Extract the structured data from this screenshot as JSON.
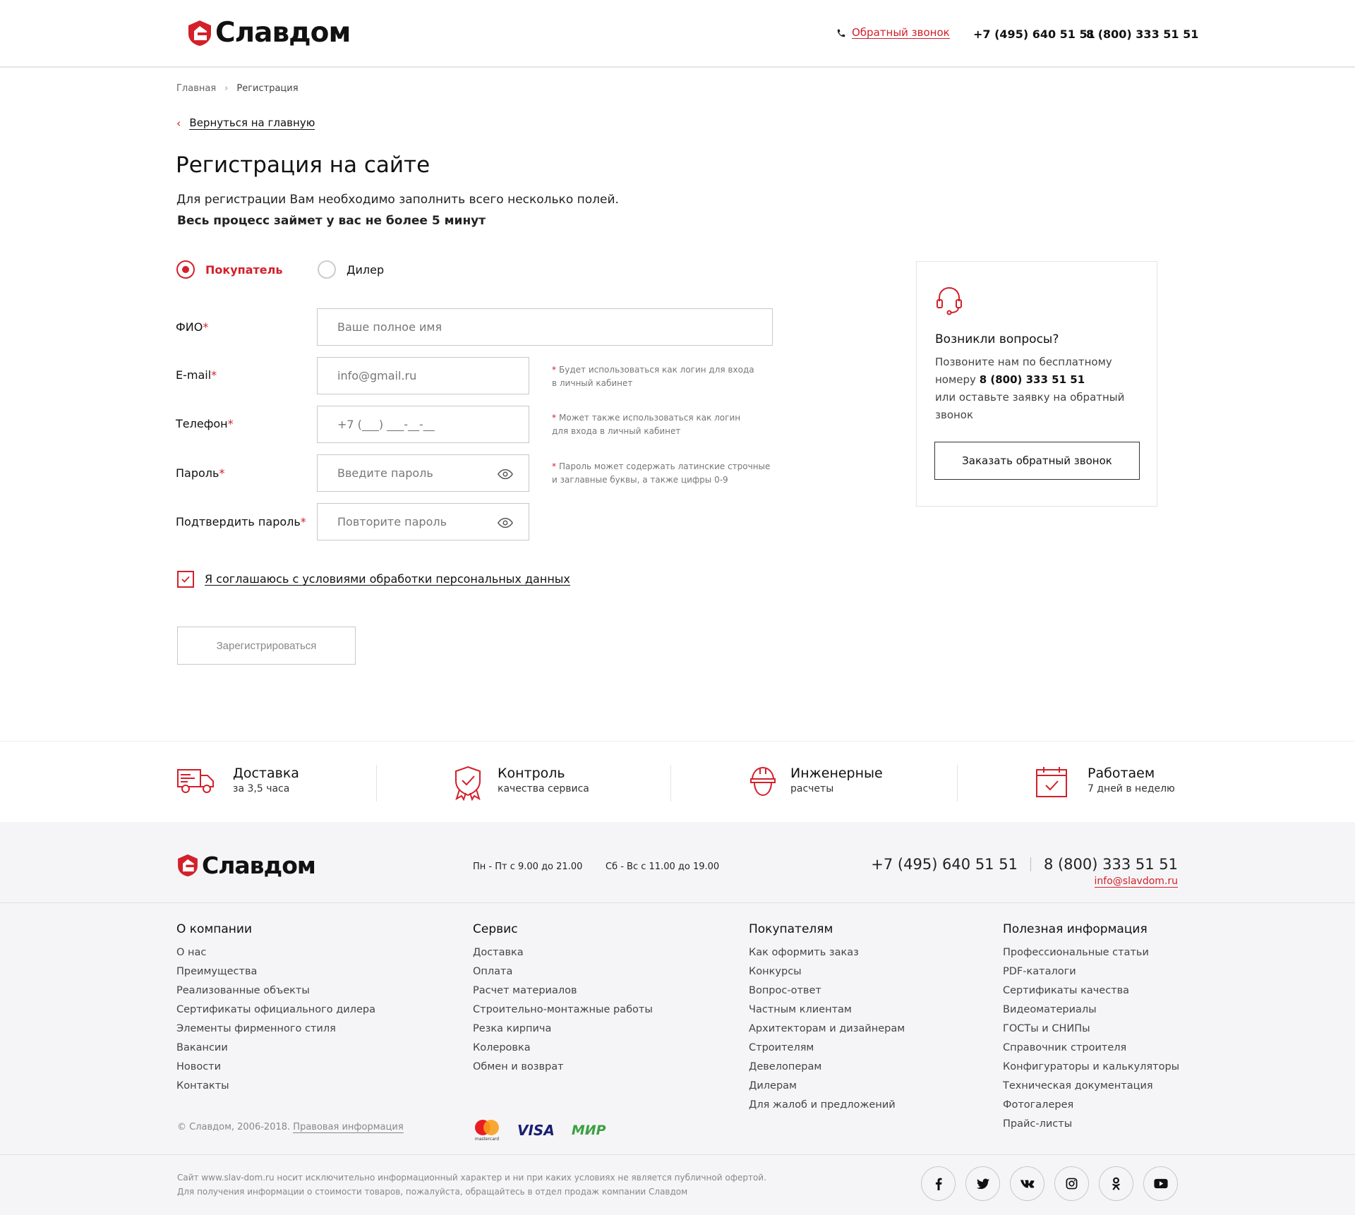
{
  "brand": {
    "name": "Славдом",
    "accent": "#d3202a"
  },
  "header": {
    "callback_link": "Обратный звонок",
    "phone1": "+7 (495) 640 51 51",
    "phone2": "8 (800) 333 51 51"
  },
  "breadcrumb": {
    "home": "Главная",
    "current": "Регистрация"
  },
  "back_link": "Вернуться на главную",
  "page": {
    "title": "Регистрация на сайте",
    "subtitle": "Для регистрации Вам необходимо заполнить всего несколько полей.",
    "subtitle_bold": "Весь процесс займет у вас не более 5 минут"
  },
  "user_type": {
    "buyer": "Покупатель",
    "dealer": "Дилер",
    "selected": "Покупатель"
  },
  "form": {
    "fio": {
      "label": "ФИО",
      "placeholder": "Ваше полное имя"
    },
    "email": {
      "label": "E-mail",
      "placeholder": "info@gmail.ru",
      "hint_line1": "Будет использоваться как логин для входа",
      "hint_line2": "в личный кабинет"
    },
    "phone": {
      "label": "Телефон",
      "placeholder": "+7 (___) ___-__-__",
      "hint_line1": "Может также использоваться как логин",
      "hint_line2": "для входа в личный кабинет"
    },
    "password": {
      "label": "Пароль",
      "placeholder": "Введите пароль",
      "hint_line1": "Пароль может содержать латинские строчные",
      "hint_line2": "и заглавные буквы, а также цифры 0-9"
    },
    "confirm": {
      "label": "Подтвердить пароль",
      "placeholder": "Повторите пароль"
    },
    "required_mark": "*",
    "agree_label": "Я соглашаюсь с условиями обработки персональных данных",
    "agree_checked": true,
    "submit": "Зарегистрироваться"
  },
  "help": {
    "title": "Возникли вопросы?",
    "text1": "Позвоните нам по бесплатному номеру",
    "phone": "8 (800) 333 51 51",
    "text2": "или оставьте заявку на обратный звонок",
    "button": "Заказать обратный звонок"
  },
  "features": [
    {
      "icon": "truck-icon",
      "title": "Доставка",
      "sub": "за 3,5 часа"
    },
    {
      "icon": "shield-check-icon",
      "title": "Контроль",
      "sub": "качества сервиса"
    },
    {
      "icon": "hard-hat-icon",
      "title": "Инженерные",
      "sub": "расчеты"
    },
    {
      "icon": "calendar-check-icon",
      "title": "Работаем",
      "sub": "7 дней в неделю"
    }
  ],
  "footer": {
    "hours_weekdays": "Пн - Пт с 9.00 до 21.00",
    "hours_weekend": "Сб - Вс с 11.00 до 19.00",
    "phone1": "+7 (495) 640 51 51",
    "phone2": "8 (800) 333 51 51",
    "email": "info@slavdom.ru",
    "columns": [
      {
        "title": "О компании",
        "items": [
          "О нас",
          "Преимущества",
          "Реализованные объекты",
          "Сертификаты официального дилера",
          "Элементы фирменного стиля",
          "Вакансии",
          "Новости",
          "Контакты"
        ]
      },
      {
        "title": "Сервис",
        "items": [
          "Доставка",
          "Оплата",
          "Расчет материалов",
          "Строительно-монтажные работы",
          "Резка кирпича",
          "Колеровка",
          "Обмен и возврат"
        ]
      },
      {
        "title": "Покупателям",
        "items": [
          "Как оформить заказ",
          "Конкурсы",
          "Вопрос-ответ",
          "Частным клиентам",
          "Архитекторам и дизайнерам",
          "Строителям",
          "Девелоперам",
          "Дилерам",
          "Для жалоб и предложений"
        ]
      },
      {
        "title": "Полезная информация",
        "items": [
          "Профессиональные статьи",
          "PDF-каталоги",
          "Сертификаты качества",
          "Видеоматериалы",
          "ГОСТы и СНИПы",
          "Справочник строителя",
          "Конфигураторы и калькуляторы",
          "Техническая документация",
          "Фотогалерея",
          "Прайс-листы"
        ]
      }
    ],
    "copyright": "© Славдом, 2006-2018.",
    "legal_link": "Правовая информация",
    "payments": {
      "mastercard": "mastercard",
      "visa": "VISA",
      "mir": "МИР"
    },
    "disclaimer1": "Сайт www.slav-dom.ru носит исключительно информационный характер и ни при каких условиях не является публичной офертой.",
    "disclaimer2": "Для получения информации о стоимости товаров, пожалуйста, обращайтесь в отдел продаж компании Славдом",
    "socials": [
      "facebook-icon",
      "twitter-icon",
      "vk-icon",
      "instagram-icon",
      "odnoklassniki-icon",
      "youtube-icon"
    ]
  }
}
